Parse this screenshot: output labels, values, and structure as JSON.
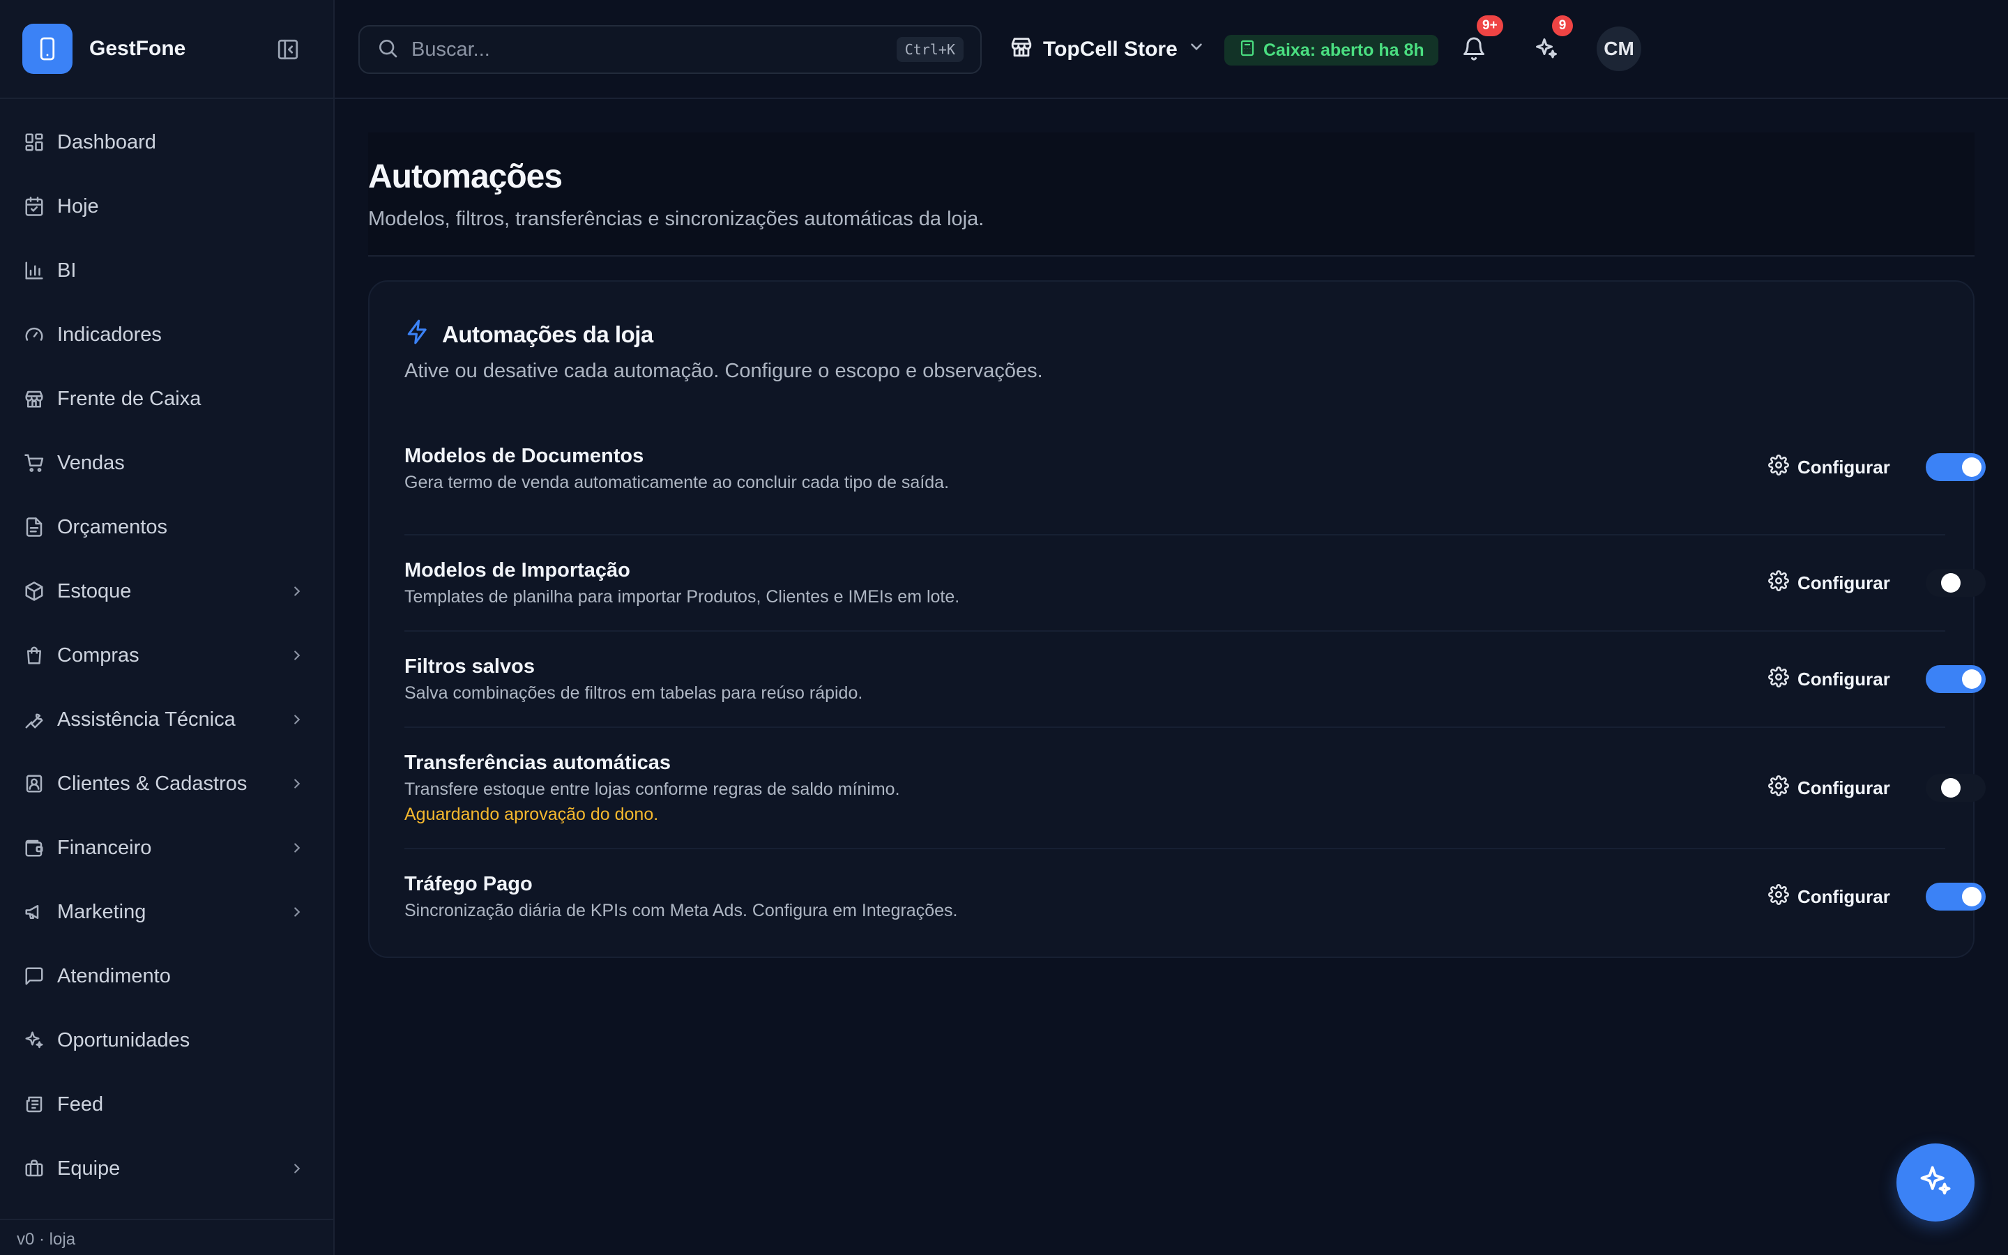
{
  "app": {
    "name": "GestFone",
    "version_label": "v0 · loja"
  },
  "sidebar": {
    "items": [
      {
        "label": "Dashboard",
        "icon": "layout-grid-icon",
        "has_children": false
      },
      {
        "label": "Hoje",
        "icon": "calendar-icon",
        "has_children": false
      },
      {
        "label": "BI",
        "icon": "bar-chart-icon",
        "has_children": false
      },
      {
        "label": "Indicadores",
        "icon": "gauge-icon",
        "has_children": false
      },
      {
        "label": "Frente de Caixa",
        "icon": "store-icon",
        "has_children": false
      },
      {
        "label": "Vendas",
        "icon": "cart-icon",
        "has_children": false
      },
      {
        "label": "Orçamentos",
        "icon": "file-text-icon",
        "has_children": false
      },
      {
        "label": "Estoque",
        "icon": "package-icon",
        "has_children": true
      },
      {
        "label": "Compras",
        "icon": "shopping-bag-icon",
        "has_children": true
      },
      {
        "label": "Assistência Técnica",
        "icon": "wrench-icon",
        "has_children": true
      },
      {
        "label": "Clientes & Cadastros",
        "icon": "contact-icon",
        "has_children": true
      },
      {
        "label": "Financeiro",
        "icon": "wallet-icon",
        "has_children": true
      },
      {
        "label": "Marketing",
        "icon": "megaphone-icon",
        "has_children": true
      },
      {
        "label": "Atendimento",
        "icon": "message-square-icon",
        "has_children": false
      },
      {
        "label": "Oportunidades",
        "icon": "sparkles-icon",
        "has_children": false
      },
      {
        "label": "Feed",
        "icon": "newspaper-icon",
        "has_children": false
      },
      {
        "label": "Equipe",
        "icon": "briefcase-icon",
        "has_children": true
      }
    ]
  },
  "topbar": {
    "search": {
      "placeholder": "Buscar...",
      "shortcut": "Ctrl+K"
    },
    "store": {
      "name": "TopCell Store"
    },
    "cash_status": "Caixa: aberto ha 8h",
    "notifications_badge": "9+",
    "insights_badge": "9",
    "avatar_initials": "CM"
  },
  "page": {
    "title": "Automações",
    "subtitle": "Modelos, filtros, transferências e sincronizações automáticas da loja."
  },
  "card": {
    "title": "Automações da loja",
    "subtitle": "Ative ou desative cada automação. Configure o escopo e observações.",
    "configure_label": "Configurar",
    "automations": [
      {
        "name": "Modelos de Documentos",
        "description": "Gera termo de venda automaticamente ao concluir cada tipo de saída.",
        "note": "",
        "enabled": true
      },
      {
        "name": "Modelos de Importação",
        "description": "Templates de planilha para importar Produtos, Clientes e IMEIs em lote.",
        "note": "",
        "enabled": false
      },
      {
        "name": "Filtros salvos",
        "description": "Salva combinações de filtros em tabelas para reúso rápido.",
        "note": "",
        "enabled": true
      },
      {
        "name": "Transferências automáticas",
        "description": "Transfere estoque entre lojas conforme regras de saldo mínimo.",
        "note": "Aguardando aprovação do dono.",
        "enabled": false
      },
      {
        "name": "Tráfego Pago",
        "description": "Sincronização diária de KPIs com Meta Ads. Configura em Integrações.",
        "note": "",
        "enabled": true
      }
    ]
  },
  "colors": {
    "accent": "#3b82f6",
    "background": "#0b1120",
    "sidebar": "#0f1626",
    "success": "#4ade80",
    "warning": "#f5b82e",
    "badge": "#ef4444"
  }
}
